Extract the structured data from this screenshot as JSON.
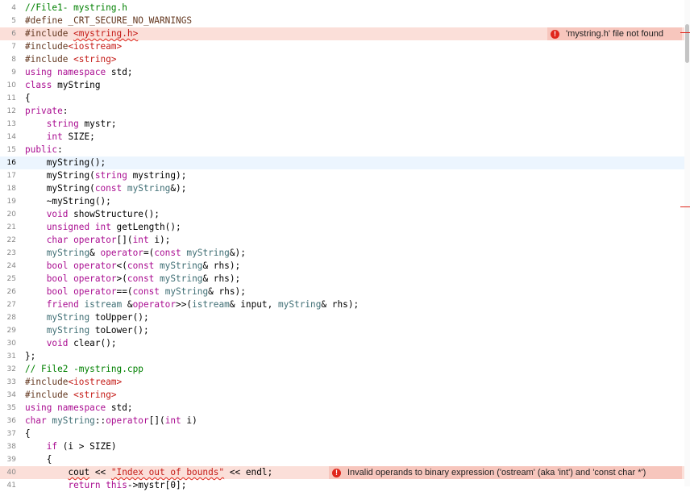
{
  "editor": {
    "lines": [
      {
        "num": "4",
        "tokens": [
          {
            "t": "//File1- mystring.h",
            "c": "cm"
          }
        ]
      },
      {
        "num": "5",
        "tokens": [
          {
            "t": "#define _CRT_SECURE_NO_WARNINGS",
            "c": "pp"
          }
        ]
      },
      {
        "num": "6",
        "state": "error",
        "tokens": [
          {
            "t": "#include ",
            "c": "pp"
          },
          {
            "t": "<mystring.h>",
            "c": "str",
            "squiggle": true
          }
        ],
        "diagnostic": {
          "text": "'mystring.h' file not found",
          "icon": "error-icon"
        }
      },
      {
        "num": "7",
        "tokens": [
          {
            "t": "#include",
            "c": "pp"
          },
          {
            "t": "<iostream>",
            "c": "str"
          }
        ]
      },
      {
        "num": "8",
        "tokens": [
          {
            "t": "#include ",
            "c": "pp"
          },
          {
            "t": "<string>",
            "c": "str"
          }
        ]
      },
      {
        "num": "9",
        "tokens": [
          {
            "t": "using namespace",
            "c": "kw"
          },
          {
            "t": " std;",
            "c": ""
          }
        ]
      },
      {
        "num": "10",
        "tokens": [
          {
            "t": "class",
            "c": "kw"
          },
          {
            "t": " myString",
            "c": ""
          }
        ]
      },
      {
        "num": "11",
        "tokens": [
          {
            "t": "{",
            "c": ""
          }
        ]
      },
      {
        "num": "12",
        "tokens": [
          {
            "t": "private",
            "c": "kw"
          },
          {
            "t": ":",
            "c": ""
          }
        ]
      },
      {
        "num": "13",
        "tokens": [
          {
            "t": "    ",
            "c": ""
          },
          {
            "t": "string",
            "c": "kw"
          },
          {
            "t": " mystr;",
            "c": ""
          }
        ]
      },
      {
        "num": "14",
        "tokens": [
          {
            "t": "    ",
            "c": ""
          },
          {
            "t": "int",
            "c": "kw"
          },
          {
            "t": " SIZE;",
            "c": ""
          }
        ]
      },
      {
        "num": "15",
        "tokens": [
          {
            "t": "public",
            "c": "kw"
          },
          {
            "t": ":",
            "c": ""
          }
        ]
      },
      {
        "num": "16",
        "state": "current",
        "tokens": [
          {
            "t": "    myString();",
            "c": ""
          }
        ]
      },
      {
        "num": "17",
        "tokens": [
          {
            "t": "    myString(",
            "c": ""
          },
          {
            "t": "string",
            "c": "kw"
          },
          {
            "t": " mystring);",
            "c": ""
          }
        ]
      },
      {
        "num": "18",
        "tokens": [
          {
            "t": "    myString(",
            "c": ""
          },
          {
            "t": "const",
            "c": "kw"
          },
          {
            "t": " ",
            "c": ""
          },
          {
            "t": "myString",
            "c": "ty"
          },
          {
            "t": "&);",
            "c": ""
          }
        ]
      },
      {
        "num": "19",
        "tokens": [
          {
            "t": "    ~myString();",
            "c": ""
          }
        ]
      },
      {
        "num": "20",
        "tokens": [
          {
            "t": "    ",
            "c": ""
          },
          {
            "t": "void",
            "c": "kw"
          },
          {
            "t": " showStructure();",
            "c": ""
          }
        ]
      },
      {
        "num": "21",
        "tokens": [
          {
            "t": "    ",
            "c": ""
          },
          {
            "t": "unsigned int",
            "c": "kw"
          },
          {
            "t": " getLength();",
            "c": ""
          }
        ]
      },
      {
        "num": "22",
        "tokens": [
          {
            "t": "    ",
            "c": ""
          },
          {
            "t": "char operator",
            "c": "kw"
          },
          {
            "t": "[](",
            "c": ""
          },
          {
            "t": "int",
            "c": "kw"
          },
          {
            "t": " i);",
            "c": ""
          }
        ]
      },
      {
        "num": "23",
        "tokens": [
          {
            "t": "    ",
            "c": ""
          },
          {
            "t": "myString",
            "c": "ty"
          },
          {
            "t": "& ",
            "c": ""
          },
          {
            "t": "operator",
            "c": "kw"
          },
          {
            "t": "=(",
            "c": ""
          },
          {
            "t": "const",
            "c": "kw"
          },
          {
            "t": " ",
            "c": ""
          },
          {
            "t": "myString",
            "c": "ty"
          },
          {
            "t": "&);",
            "c": ""
          }
        ]
      },
      {
        "num": "24",
        "tokens": [
          {
            "t": "    ",
            "c": ""
          },
          {
            "t": "bool operator",
            "c": "kw"
          },
          {
            "t": "<(",
            "c": ""
          },
          {
            "t": "const",
            "c": "kw"
          },
          {
            "t": " ",
            "c": ""
          },
          {
            "t": "myString",
            "c": "ty"
          },
          {
            "t": "& rhs);",
            "c": ""
          }
        ]
      },
      {
        "num": "25",
        "tokens": [
          {
            "t": "    ",
            "c": ""
          },
          {
            "t": "bool operator",
            "c": "kw"
          },
          {
            "t": ">(",
            "c": ""
          },
          {
            "t": "const",
            "c": "kw"
          },
          {
            "t": " ",
            "c": ""
          },
          {
            "t": "myString",
            "c": "ty"
          },
          {
            "t": "& rhs);",
            "c": ""
          }
        ]
      },
      {
        "num": "26",
        "tokens": [
          {
            "t": "    ",
            "c": ""
          },
          {
            "t": "bool operator",
            "c": "kw"
          },
          {
            "t": "==(",
            "c": ""
          },
          {
            "t": "const",
            "c": "kw"
          },
          {
            "t": " ",
            "c": ""
          },
          {
            "t": "myString",
            "c": "ty"
          },
          {
            "t": "& rhs);",
            "c": ""
          }
        ]
      },
      {
        "num": "27",
        "tokens": [
          {
            "t": "    ",
            "c": ""
          },
          {
            "t": "friend",
            "c": "kw"
          },
          {
            "t": " ",
            "c": ""
          },
          {
            "t": "istream",
            "c": "ty"
          },
          {
            "t": " &",
            "c": ""
          },
          {
            "t": "operator",
            "c": "kw"
          },
          {
            "t": ">>(",
            "c": ""
          },
          {
            "t": "istream",
            "c": "ty"
          },
          {
            "t": "& input, ",
            "c": ""
          },
          {
            "t": "myString",
            "c": "ty"
          },
          {
            "t": "& rhs);",
            "c": ""
          }
        ]
      },
      {
        "num": "28",
        "tokens": [
          {
            "t": "    ",
            "c": ""
          },
          {
            "t": "myString",
            "c": "ty"
          },
          {
            "t": " toUpper();",
            "c": ""
          }
        ]
      },
      {
        "num": "29",
        "tokens": [
          {
            "t": "    ",
            "c": ""
          },
          {
            "t": "myString",
            "c": "ty"
          },
          {
            "t": " toLower();",
            "c": ""
          }
        ]
      },
      {
        "num": "30",
        "tokens": [
          {
            "t": "    ",
            "c": ""
          },
          {
            "t": "void",
            "c": "kw"
          },
          {
            "t": " clear();",
            "c": ""
          }
        ]
      },
      {
        "num": "31",
        "tokens": [
          {
            "t": "};",
            "c": ""
          }
        ]
      },
      {
        "num": "32",
        "tokens": [
          {
            "t": "// File2 -mystring.cpp",
            "c": "cm"
          }
        ]
      },
      {
        "num": "33",
        "tokens": [
          {
            "t": "#include",
            "c": "pp"
          },
          {
            "t": "<iostream>",
            "c": "str"
          }
        ]
      },
      {
        "num": "34",
        "tokens": [
          {
            "t": "#include ",
            "c": "pp"
          },
          {
            "t": "<string>",
            "c": "str"
          }
        ]
      },
      {
        "num": "35",
        "tokens": [
          {
            "t": "using namespace",
            "c": "kw"
          },
          {
            "t": " std;",
            "c": ""
          }
        ]
      },
      {
        "num": "36",
        "tokens": [
          {
            "t": "char",
            "c": "kw"
          },
          {
            "t": " ",
            "c": ""
          },
          {
            "t": "myString",
            "c": "ty"
          },
          {
            "t": "::",
            "c": ""
          },
          {
            "t": "operator",
            "c": "kw"
          },
          {
            "t": "[](",
            "c": ""
          },
          {
            "t": "int",
            "c": "kw"
          },
          {
            "t": " i)",
            "c": ""
          }
        ]
      },
      {
        "num": "37",
        "tokens": [
          {
            "t": "{",
            "c": ""
          }
        ]
      },
      {
        "num": "38",
        "tokens": [
          {
            "t": "    ",
            "c": ""
          },
          {
            "t": "if",
            "c": "kw"
          },
          {
            "t": " (i > SIZE)",
            "c": ""
          }
        ]
      },
      {
        "num": "39",
        "tokens": [
          {
            "t": "    {",
            "c": ""
          }
        ]
      },
      {
        "num": "40",
        "state": "error",
        "tokens": [
          {
            "t": "        ",
            "c": ""
          },
          {
            "t": "cout",
            "c": "",
            "squiggle": true
          },
          {
            "t": " << ",
            "c": ""
          },
          {
            "t": "\"Index out of bounds\"",
            "c": "str",
            "squiggle": true
          },
          {
            "t": " << endl;",
            "c": ""
          }
        ],
        "diagnostic": {
          "text": "Invalid operands to binary expression ('ostream' (aka 'int') and 'const char *')",
          "icon": "error-icon"
        }
      },
      {
        "num": "41",
        "tokens": [
          {
            "t": "        ",
            "c": ""
          },
          {
            "t": "return this",
            "c": "kw"
          },
          {
            "t": "->mystr[0];",
            "c": ""
          }
        ]
      }
    ]
  },
  "colors": {
    "keyword": "#aa0d91",
    "preprocessor": "#643820",
    "string": "#c41a16",
    "comment": "#008000",
    "type": "#3f6e74",
    "error_line_bg": "#fbdfd9",
    "error_badge_bg": "#f7c6bd",
    "current_line_bg": "#ecf5fe"
  }
}
